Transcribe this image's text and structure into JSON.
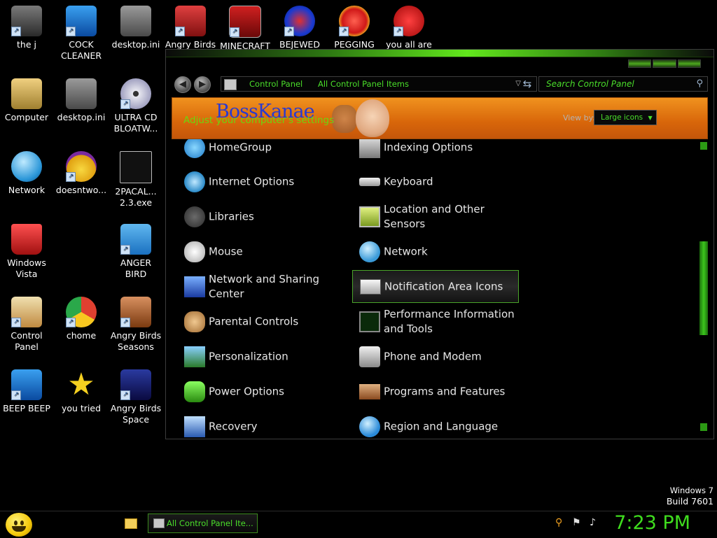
{
  "desktop": {
    "icons": [
      {
        "label": "the j",
        "name": "the-j",
        "color": "#5a5a5a"
      },
      {
        "label": "COCK CLEANER",
        "name": "cock-cleaner",
        "color": "#1a78d8"
      },
      {
        "label": "desktop.ini",
        "name": "desktop-ini-top",
        "color": "#777"
      },
      {
        "label": "Angry Birds",
        "name": "angry-birds",
        "color": "#c02020"
      },
      {
        "label": "MINECRAFT",
        "name": "minecraft",
        "color": "#b01818"
      },
      {
        "label": "BEJEWED",
        "name": "bejeweled",
        "color": "#1a5ad0"
      },
      {
        "label": "PEGGING",
        "name": "pegging",
        "color": "#e0202a"
      },
      {
        "label": "you all are",
        "name": "you-all-are",
        "color": "#d01818"
      },
      {
        "label": "Computer",
        "name": "computer",
        "color": "#c8c8c8"
      },
      {
        "label": "desktop.ini",
        "name": "desktop-ini",
        "color": "#777"
      },
      {
        "label": "ULTRA CD BLOATW...",
        "name": "ultra-cd",
        "color": "#c0c0d0"
      },
      {
        "label": "Network",
        "name": "network",
        "color": "#3aa6e0"
      },
      {
        "label": "doesntwo...",
        "name": "doesntwork",
        "color": "#7a2aa0"
      },
      {
        "label": "2PACAL... 2.3.exe",
        "name": "2pacal-exe",
        "color": "#222"
      },
      {
        "label": "Windows Vista",
        "name": "windows-vista",
        "color": "#d01818"
      },
      {
        "label": "ANGER BIRD",
        "name": "anger-bird",
        "color": "#d82020"
      },
      {
        "label": "Control Panel",
        "name": "control-panel",
        "color": "#e8c870"
      },
      {
        "label": "chome",
        "name": "chome",
        "color": "#e04030"
      },
      {
        "label": "Angry Birds Seasons",
        "name": "angry-birds-seasons",
        "color": "#b06a30"
      },
      {
        "label": "BEEP BEEP",
        "name": "beep-beep",
        "color": "#1a78d8"
      },
      {
        "label": "you tried",
        "name": "you-tried",
        "color": "#f0d020"
      },
      {
        "label": "Angry Birds Space",
        "name": "angry-birds-space",
        "color": "#1a2a8a"
      }
    ]
  },
  "window": {
    "breadcrumb": [
      "Control Panel",
      "All Control Panel Items"
    ],
    "search_placeholder": "Search Control Panel",
    "banner": {
      "brand": "BossKanae",
      "adjust": "Adjust your computer's settings",
      "view_by": "View by:",
      "view_value": "Large icons"
    },
    "items_left": [
      {
        "label": "HomeGroup",
        "icon": "homegroup-icon"
      },
      {
        "label": "Internet Options",
        "icon": "internet-options-icon"
      },
      {
        "label": "Libraries",
        "icon": "libraries-icon"
      },
      {
        "label": "Mouse",
        "icon": "mouse-icon"
      },
      {
        "label": "Network and Sharing Center",
        "icon": "network-sharing-icon"
      },
      {
        "label": "Parental Controls",
        "icon": "parental-controls-icon"
      },
      {
        "label": "Personalization",
        "icon": "personalization-icon"
      },
      {
        "label": "Power Options",
        "icon": "power-options-icon"
      },
      {
        "label": "Recovery",
        "icon": "recovery-icon"
      }
    ],
    "items_right": [
      {
        "label": "Indexing Options",
        "icon": "indexing-options-icon"
      },
      {
        "label": "Keyboard",
        "icon": "keyboard-icon"
      },
      {
        "label": "Location and Other Sensors",
        "icon": "location-sensors-icon"
      },
      {
        "label": "Network",
        "icon": "network-icon"
      },
      {
        "label": "Notification Area Icons",
        "icon": "notification-area-icon"
      },
      {
        "label": "Performance Information and Tools",
        "icon": "performance-icon"
      },
      {
        "label": "Phone and Modem",
        "icon": "phone-modem-icon"
      },
      {
        "label": "Programs and Features",
        "icon": "programs-features-icon"
      },
      {
        "label": "Region and Language",
        "icon": "region-language-icon"
      }
    ]
  },
  "watermark": {
    "line1": "Windows 7",
    "line2": "Build 7601"
  },
  "taskbar": {
    "task_label": "All Control Panel Ite...",
    "clock": "7:23 PM"
  },
  "colors": {
    "accent": "#3fdc1e",
    "banner": "#e07a12"
  }
}
